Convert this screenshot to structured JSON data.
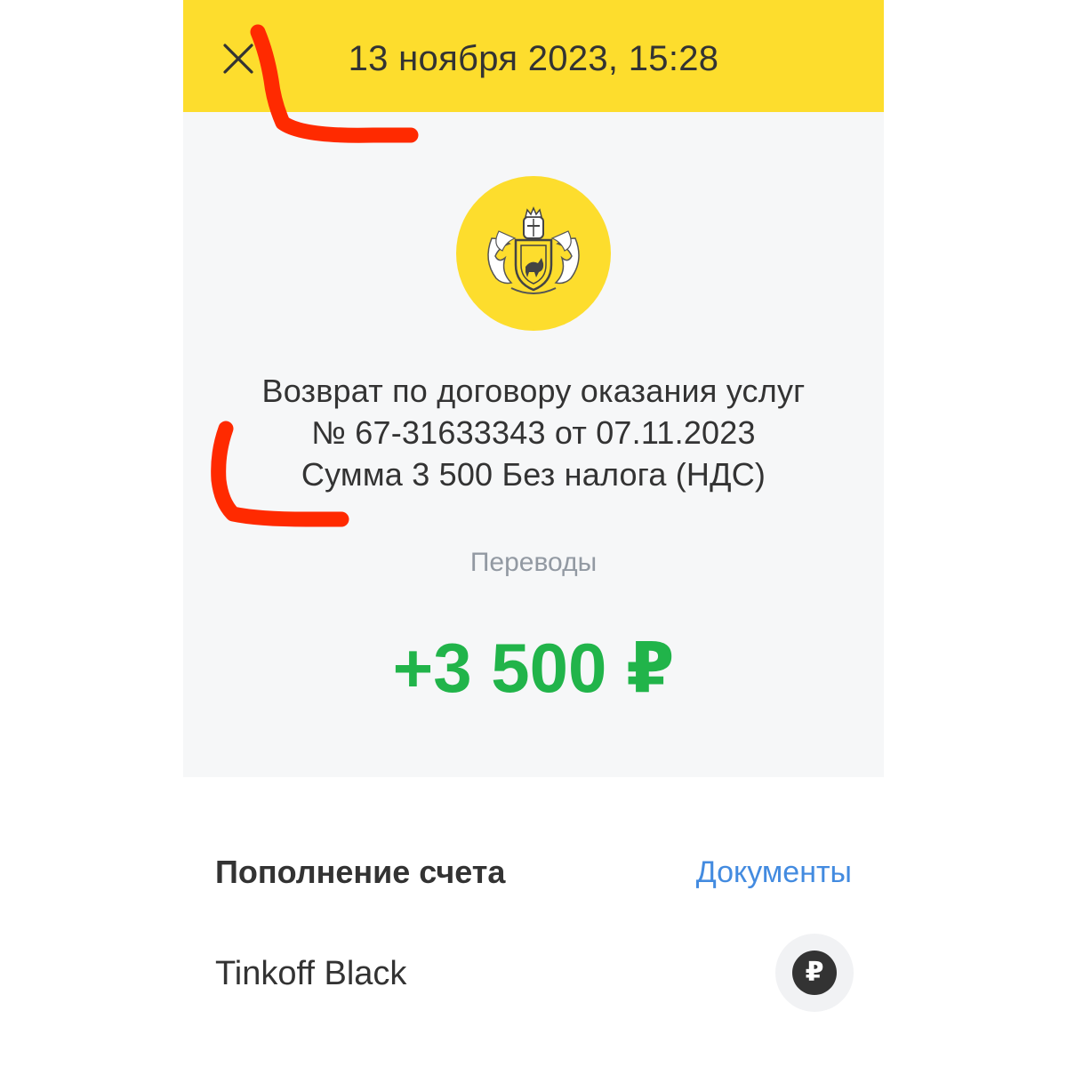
{
  "header": {
    "datetime": "13 ноября 2023, 15:28",
    "close_icon": "close-icon"
  },
  "operation": {
    "logo_icon": "bank-coat-of-arms-icon",
    "description": "Возврат по договору оказания услуг № 67-31633343 от 07.11.2023 Сумма 3 500 Без налога (НДС)",
    "category": "Переводы",
    "amount": "+3 500 ₽"
  },
  "details": {
    "section_title": "Пополнение счета",
    "documents_label": "Документы",
    "account_name": "Tinkoff Black",
    "account_icon_symbol": "₽",
    "account_icon": "ruble-icon"
  },
  "colors": {
    "header_bg": "#fddd2d",
    "hero_bg": "#f6f7f8",
    "amount_positive": "#21b44a",
    "link": "#438be0",
    "annotation_marks": "#ff2a00"
  }
}
